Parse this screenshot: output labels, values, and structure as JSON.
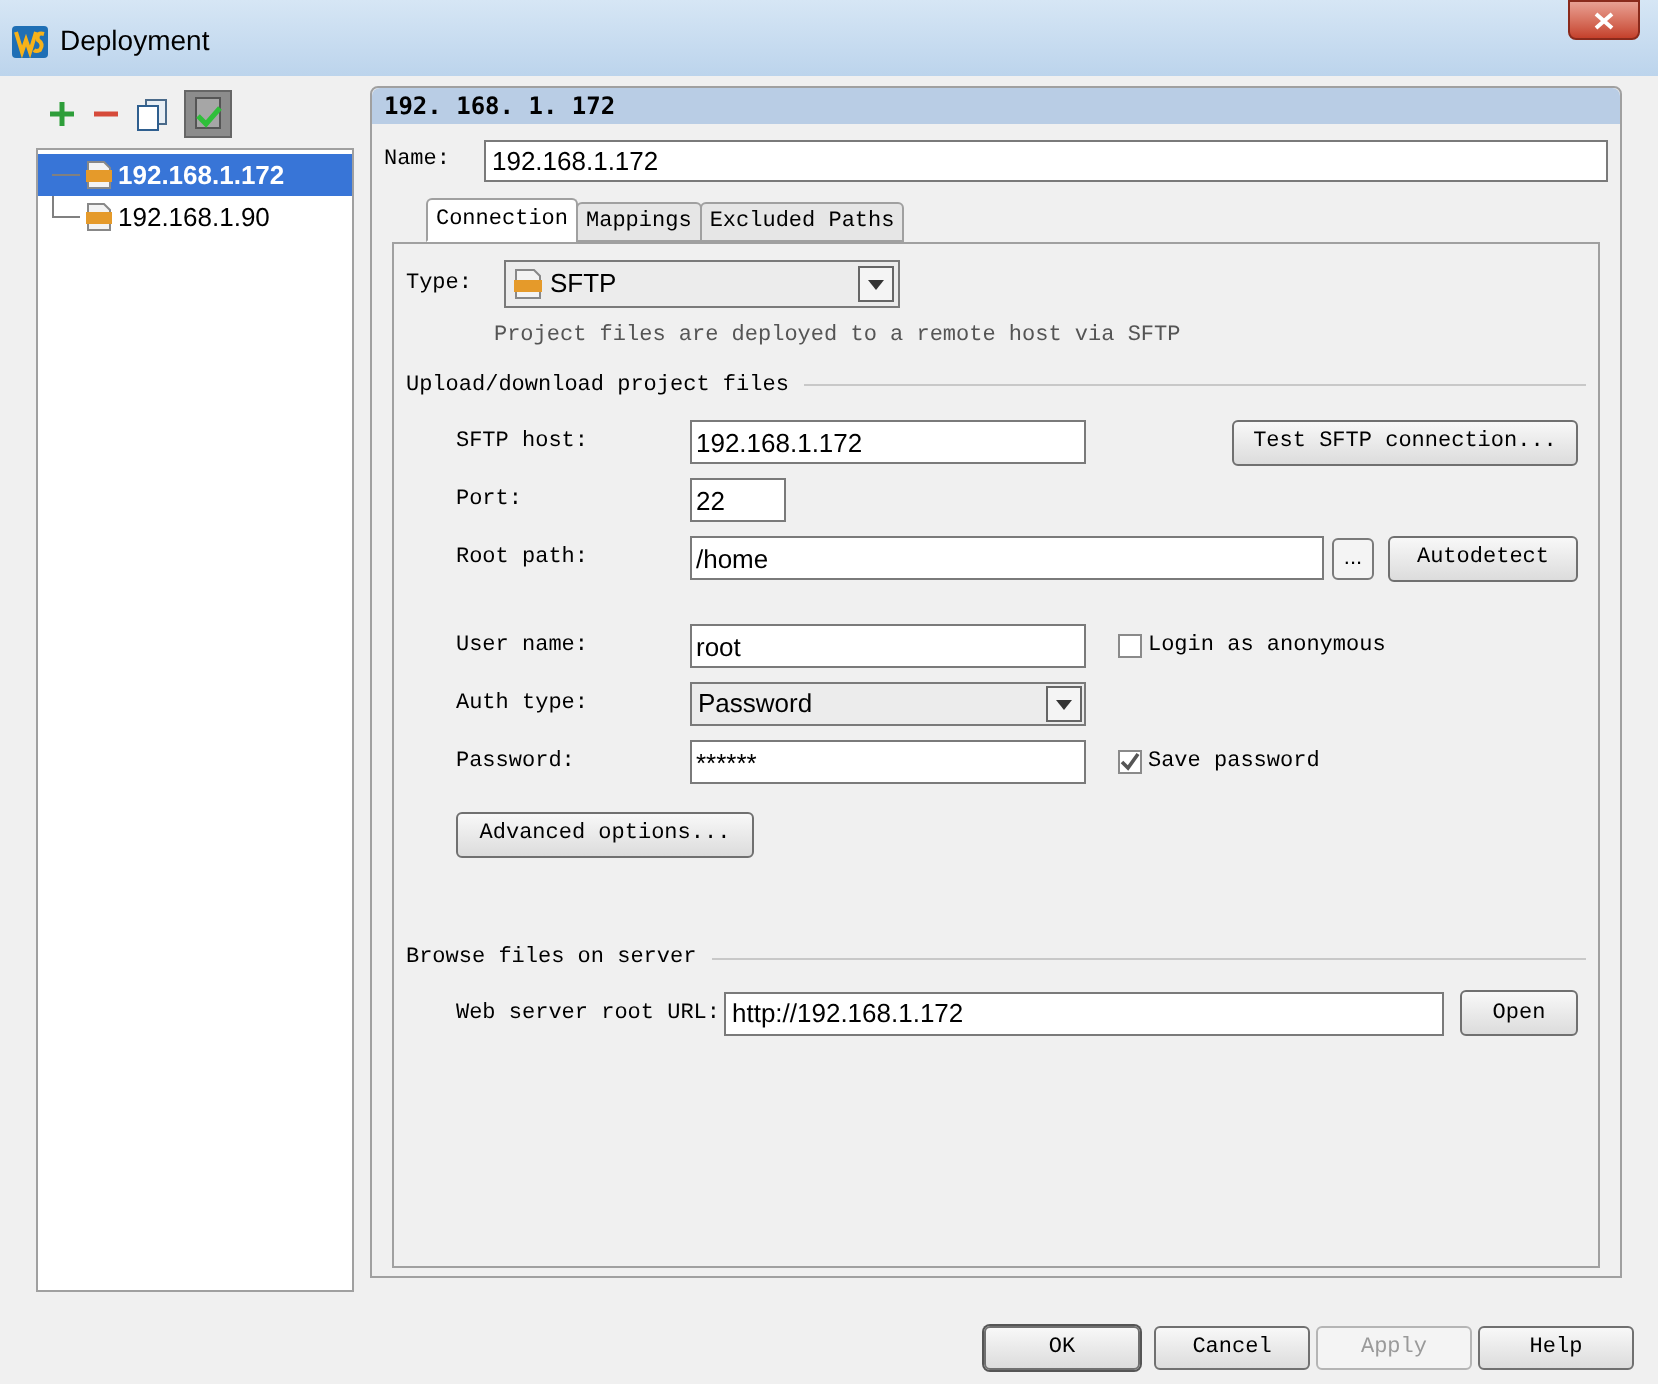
{
  "window": {
    "title": "Deployment"
  },
  "servers": [
    {
      "label": "192.168.1.172",
      "selected": true
    },
    {
      "label": "192.168.1.90",
      "selected": false
    }
  ],
  "header": "192. 168. 1. 172",
  "name": {
    "label": "Name:",
    "value": "192.168.1.172"
  },
  "tabs": [
    {
      "label": "Connection",
      "selected": true
    },
    {
      "label": "Mappings",
      "selected": false
    },
    {
      "label": "Excluded Paths",
      "selected": false
    }
  ],
  "type": {
    "label": "Type:",
    "value": "SFTP",
    "hint": "Project files are deployed to a remote host via SFTP"
  },
  "upload": {
    "title": "Upload/download project files",
    "host": {
      "label": "SFTP host:",
      "value": "192.168.1.172",
      "button": "Test SFTP connection..."
    },
    "port": {
      "label": "Port:",
      "value": "22"
    },
    "root_path": {
      "label": "Root path:",
      "value": "/home",
      "browse": "...",
      "button": "Autodetect"
    },
    "user_name": {
      "label": "User name:",
      "value": "root",
      "checkbox": {
        "label": "Login as anonymous",
        "checked": false
      }
    },
    "auth_type": {
      "label": "Auth type:",
      "value": "Password"
    },
    "password": {
      "label": "Password:",
      "value": "******",
      "checkbox": {
        "label": "Save password",
        "checked": true
      }
    },
    "advanced": "Advanced options..."
  },
  "browse": {
    "title": "Browse files on server",
    "label": "Web server root URL:",
    "value": "http://192.168.1.172",
    "button": "Open"
  },
  "buttons": [
    {
      "label": "OK",
      "kind": "default",
      "disabled": false
    },
    {
      "label": "Cancel",
      "kind": "normal",
      "disabled": false
    },
    {
      "label": "Apply",
      "kind": "normal",
      "disabled": true
    },
    {
      "label": "Help",
      "kind": "normal",
      "disabled": false
    }
  ]
}
